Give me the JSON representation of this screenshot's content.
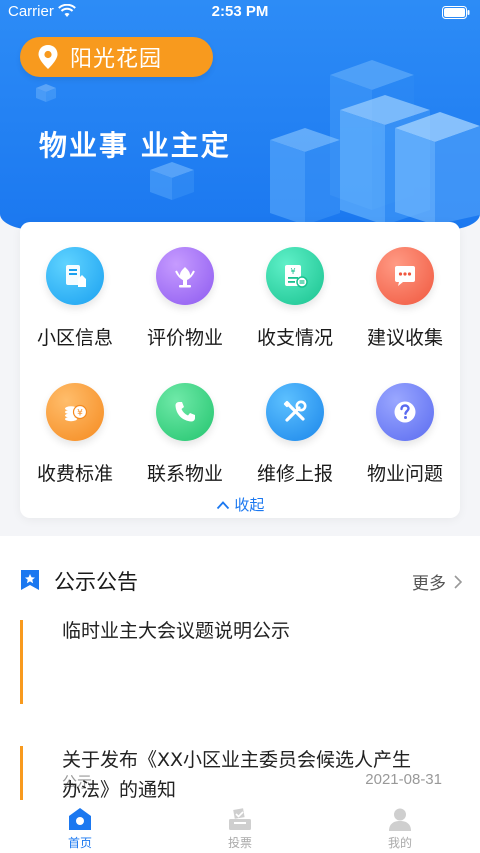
{
  "status_bar": {
    "carrier": "Carrier",
    "time": "2:53 PM"
  },
  "header": {
    "location": "阳光花园",
    "slogan": "物业事 业主定",
    "colors": {
      "primary": "#1b78f0",
      "accent": "#f89a1e"
    }
  },
  "menu": {
    "items": [
      {
        "label": "小区信息",
        "icon": "community-info-icon"
      },
      {
        "label": "评价物业",
        "icon": "rate-icon"
      },
      {
        "label": "收支情况",
        "icon": "finance-icon"
      },
      {
        "label": "建议收集",
        "icon": "chat-icon"
      },
      {
        "label": "收费标准",
        "icon": "coins-icon"
      },
      {
        "label": "联系物业",
        "icon": "phone-icon"
      },
      {
        "label": "维修上报",
        "icon": "tools-icon"
      },
      {
        "label": "物业问题",
        "icon": "question-icon"
      }
    ],
    "collapse_label": "收起"
  },
  "notices": {
    "title": "公示公告",
    "more_label": "更多",
    "items": [
      {
        "title": "临时业主大会议题说明公示",
        "tag": "公示",
        "date": "2021-08-31"
      },
      {
        "title": "关于发布《XX小区业主委员会候选人产生办法》的通知"
      }
    ]
  },
  "tabbar": {
    "items": [
      {
        "label": "首页",
        "icon": "home-icon",
        "active": true
      },
      {
        "label": "投票",
        "icon": "vote-icon",
        "active": false
      },
      {
        "label": "我的",
        "icon": "profile-icon",
        "active": false
      }
    ]
  }
}
